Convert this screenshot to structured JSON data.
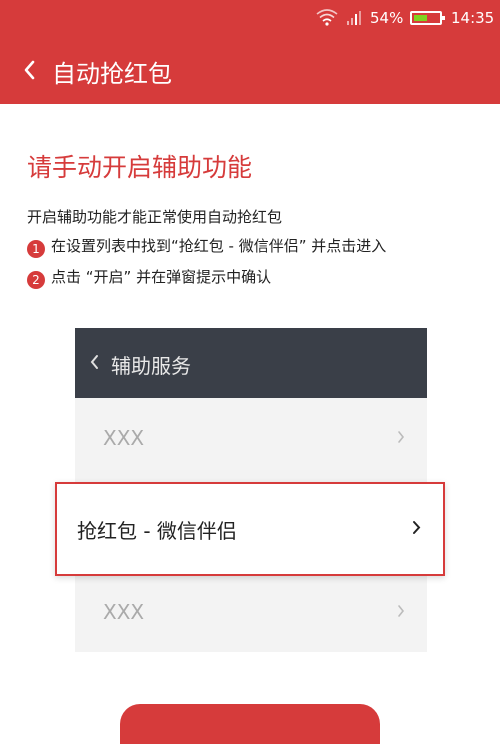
{
  "status_bar": {
    "battery_percent": "54%",
    "time": "14:35",
    "battery_level": 0.54,
    "battery_color": "#7ed321"
  },
  "app_bar": {
    "title": "自动抢红包",
    "back_icon": "chevron-left-icon"
  },
  "guide": {
    "heading": "请手动开启辅助功能",
    "intro": "开启辅助功能才能正常使用自动抢红包",
    "steps": [
      {
        "number": "1",
        "text": "在设置列表中找到“抢红包 - 微信伴侣” 并点击进入"
      },
      {
        "number": "2",
        "text": "点击 “开启” 并在弹窗提示中确认"
      }
    ]
  },
  "mock_settings": {
    "header_title": "辅助服务",
    "rows": [
      {
        "label": "XXX"
      },
      {
        "label": "抢红包 - 微信伴侣"
      },
      {
        "label": "XXX"
      }
    ]
  },
  "colors": {
    "accent": "#d63b3b",
    "mock_header": "#3a3f48",
    "mock_bg": "#f3f3f3"
  }
}
